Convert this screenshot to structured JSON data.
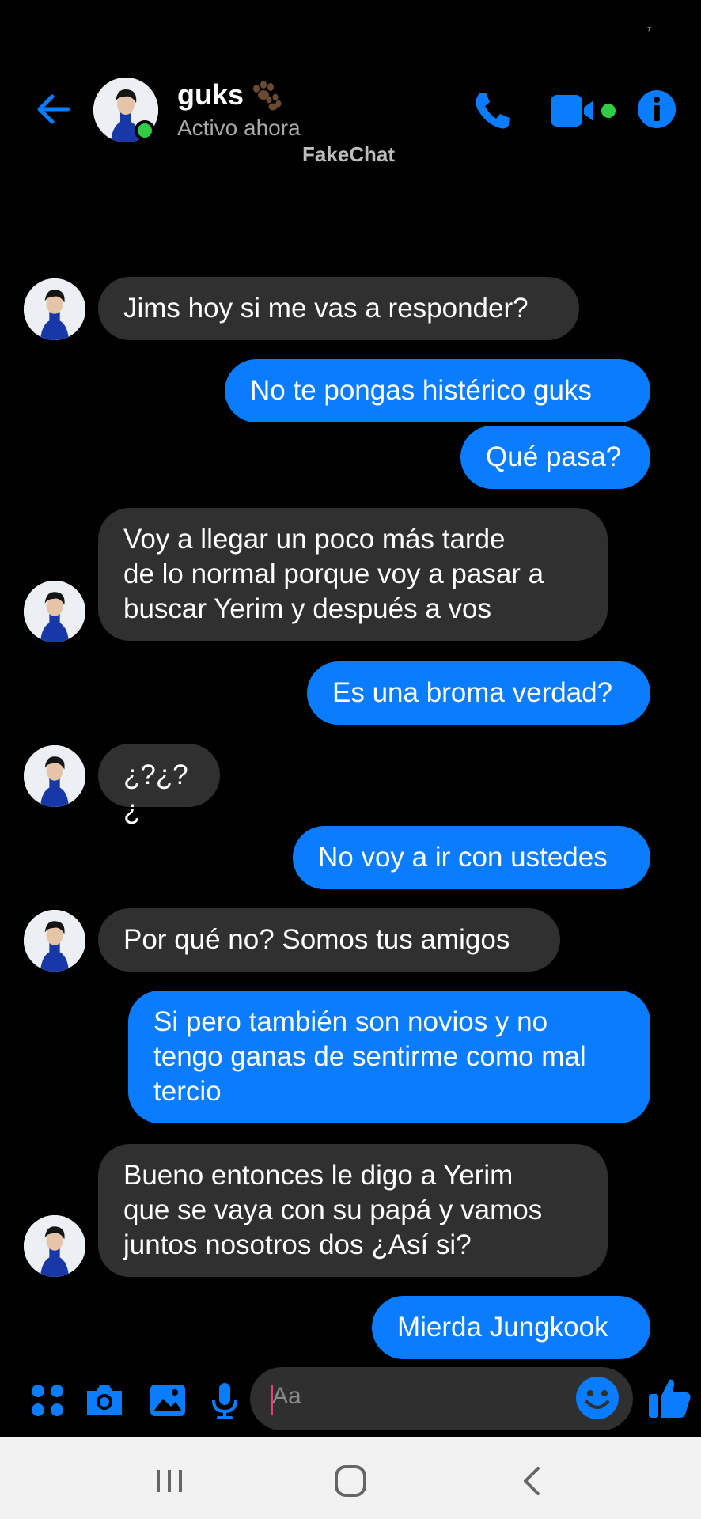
{
  "status_bar": {
    "corner": "⁷"
  },
  "header": {
    "contact_name": "guks",
    "presence": "Activo ahora",
    "watermark": "FakeChat",
    "icons": [
      "back-arrow-icon",
      "phone-icon",
      "video-camera-icon",
      "info-icon"
    ]
  },
  "messages": [
    {
      "side": "in",
      "text": "Jims hoy si me vas a responder?"
    },
    {
      "side": "out",
      "text": "No te pongas histérico guks"
    },
    {
      "side": "out",
      "text": "Qué pasa?"
    },
    {
      "side": "in",
      "text": "Voy a llegar un poco más tarde\nde lo normal porque voy a pasar a\nbuscar Yerim y después a vos"
    },
    {
      "side": "out",
      "text": "Es una broma verdad?"
    },
    {
      "side": "in",
      "text": "¿?¿?¿"
    },
    {
      "side": "out",
      "text": "No voy a ir con ustedes"
    },
    {
      "side": "in",
      "text": "Por qué no? Somos tus amigos"
    },
    {
      "side": "out",
      "text": "Si pero también son novios y no\ntengo ganas de sentirme como mal\ntercio"
    },
    {
      "side": "in",
      "text": "Bueno entonces le digo a Yerim\nque se vaya con su papá y vamos\njuntos nosotros dos ¿Así si?"
    },
    {
      "side": "out",
      "text": "Mierda Jungkook"
    }
  ],
  "composer": {
    "placeholder": "Aa",
    "icons": [
      "apps-grid-icon",
      "camera-icon",
      "gallery-icon",
      "microphone-icon",
      "emoji-icon",
      "thumbs-up-icon"
    ]
  },
  "nav": {
    "icons": [
      "recents-icon",
      "home-icon",
      "back-icon"
    ]
  },
  "colors": {
    "accent": "#0a7cff",
    "incoming_bubble": "#303030",
    "online": "#31cc46",
    "background": "#000000"
  }
}
